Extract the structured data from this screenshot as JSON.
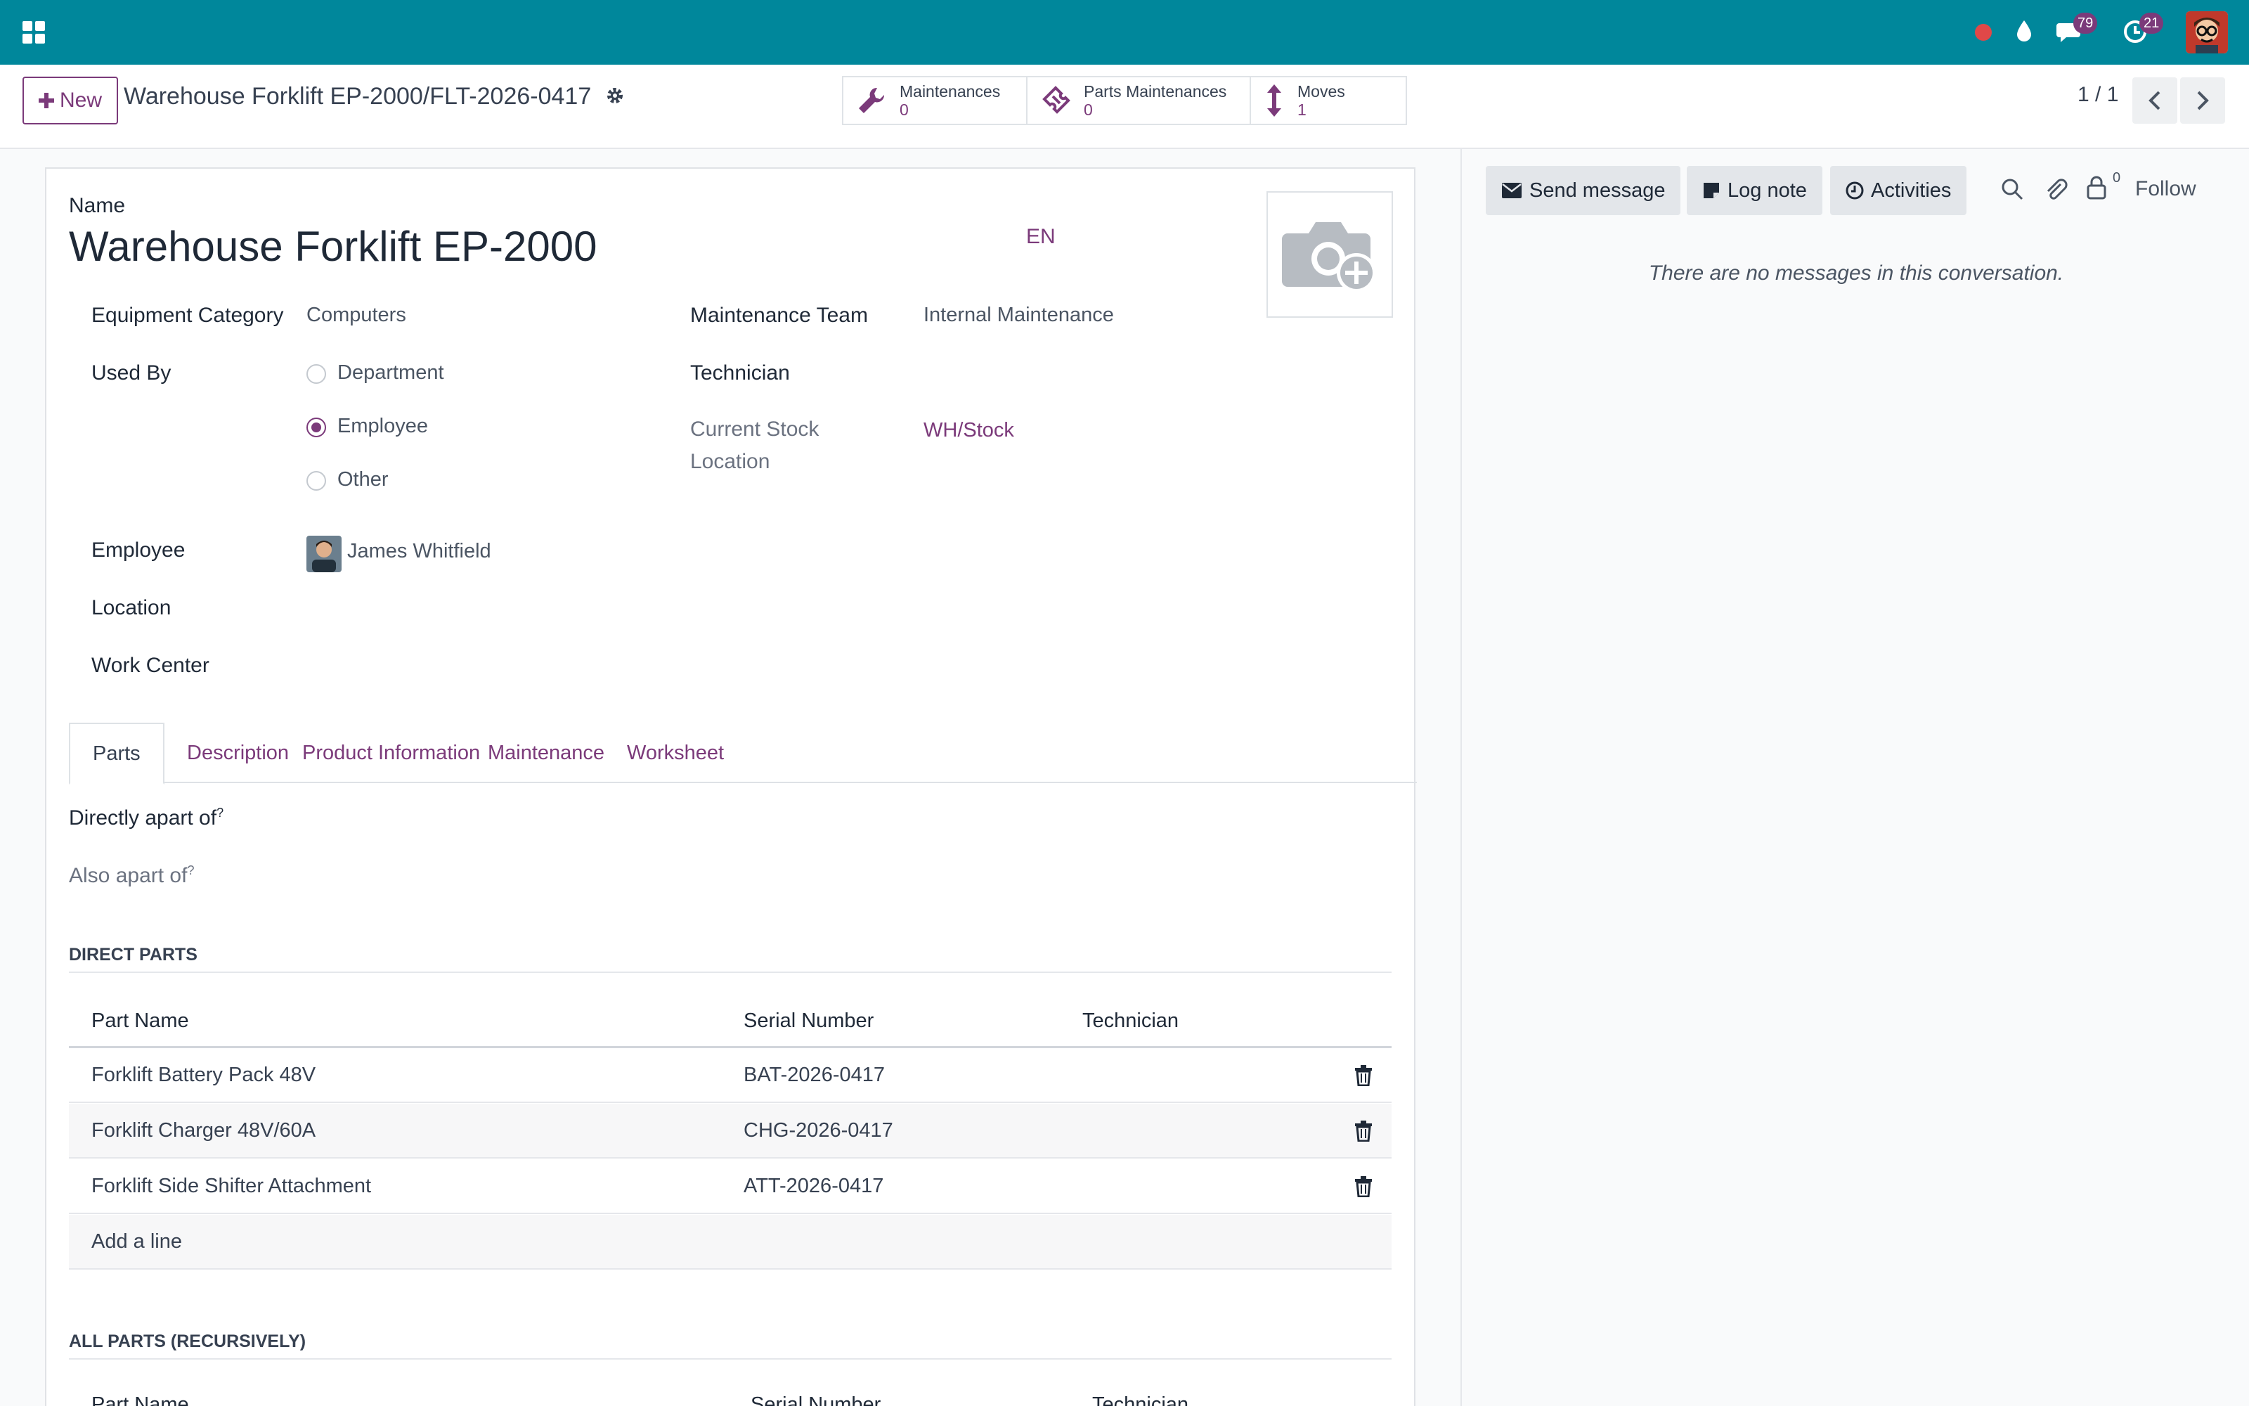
{
  "navbar": {
    "apps_icon": "grid-icon",
    "messages_count": "79",
    "activities_count": "21"
  },
  "control_panel": {
    "new_label": "New",
    "breadcrumb": "Warehouse Forklift EP-2000/FLT-2026-0417",
    "stats": [
      {
        "label": "Maintenances",
        "value": "0"
      },
      {
        "label": "Parts Maintenances",
        "value": "0"
      },
      {
        "label": "Moves",
        "value": "1"
      }
    ],
    "pager": "1 / 1"
  },
  "form": {
    "name_label": "Name",
    "name_value": "Warehouse Forklift EP-2000",
    "lang": "EN",
    "equipment_category_label": "Equipment Category",
    "equipment_category_value": "Computers",
    "used_by_label": "Used By",
    "used_by_options": [
      "Department",
      "Employee",
      "Other"
    ],
    "used_by_selected": "Employee",
    "employee_label": "Employee",
    "employee_value": "James Whitfield",
    "location_label": "Location",
    "work_center_label": "Work Center",
    "maintenance_team_label": "Maintenance Team",
    "maintenance_team_value": "Internal Maintenance",
    "technician_label": "Technician",
    "current_stock_location_label_1": "Current Stock",
    "current_stock_location_label_2": "Location",
    "current_stock_location_value": "WH/Stock"
  },
  "tabs": [
    "Parts",
    "Description",
    "Product Information",
    "Maintenance",
    "Worksheet"
  ],
  "parts_tab": {
    "directly_apart_of": "Directly apart of",
    "also_apart_of": "Also apart of",
    "help_mark": "?",
    "direct_parts_title": "DIRECT PARTS",
    "columns": [
      "Part Name",
      "Serial Number",
      "Technician"
    ],
    "rows": [
      {
        "part": "Forklift Battery Pack 48V",
        "serial": "BAT-2026-0417",
        "technician": ""
      },
      {
        "part": "Forklift Charger 48V/60A",
        "serial": "CHG-2026-0417",
        "technician": ""
      },
      {
        "part": "Forklift Side Shifter Attachment",
        "serial": "ATT-2026-0417",
        "technician": ""
      }
    ],
    "add_line": "Add a line",
    "all_parts_title": "ALL PARTS (RECURSIVELY)",
    "all_columns": [
      "Part Name",
      "Serial Number",
      "Technician"
    ]
  },
  "chatter": {
    "send_message": "Send message",
    "log_note": "Log note",
    "activities": "Activities",
    "followers_count": "0",
    "follow": "Follow",
    "empty": "There are no messages in this conversation."
  },
  "colors": {
    "navbar": "#00879b",
    "accent": "#7b3a7a"
  }
}
